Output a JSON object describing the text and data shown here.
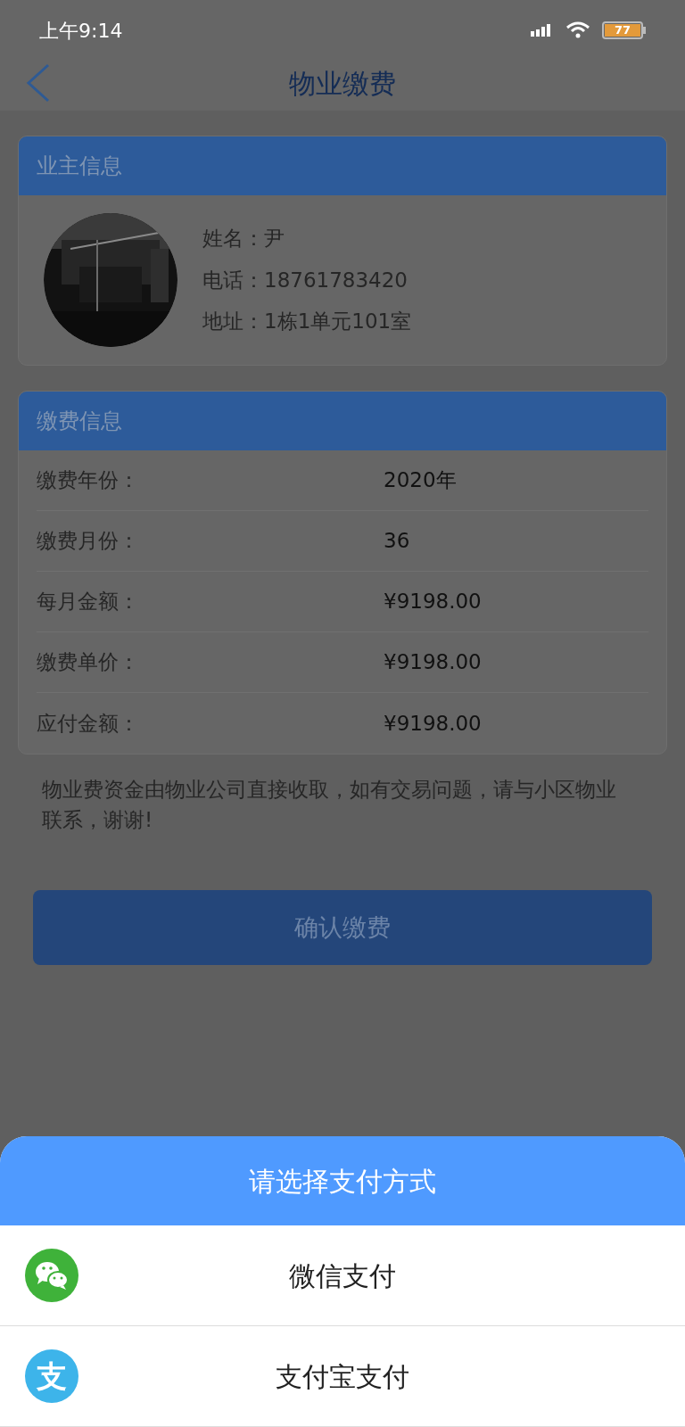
{
  "status_bar": {
    "time": "上午9:14",
    "battery": "77"
  },
  "nav": {
    "title": "物业缴费"
  },
  "owner_card": {
    "title": "业主信息",
    "fields": [
      {
        "label": "姓名：",
        "value": "尹"
      },
      {
        "label": "电话：",
        "value": "18761783420"
      },
      {
        "label": "地址：",
        "value": "1栋1单元101室"
      }
    ]
  },
  "payment_card": {
    "title": "缴费信息",
    "rows": [
      {
        "label": "缴费年份：",
        "value": "2020年"
      },
      {
        "label": "缴费月份：",
        "value": "36"
      },
      {
        "label": "每月金额：",
        "value": "¥9198.00"
      },
      {
        "label": "缴费单价：",
        "value": "¥9198.00"
      },
      {
        "label": "应付金额：",
        "value": "¥9198.00"
      }
    ]
  },
  "notice": "物业费资金由物业公司直接收取，如有交易问题，请与小区物业联系，谢谢!",
  "confirm_button": "确认缴费",
  "pay_sheet": {
    "title": "请选择支付方式",
    "options": [
      {
        "kind": "wechat",
        "label": "微信支付"
      },
      {
        "kind": "alipay",
        "icon_text": "支",
        "label": "支付宝支付"
      }
    ]
  }
}
